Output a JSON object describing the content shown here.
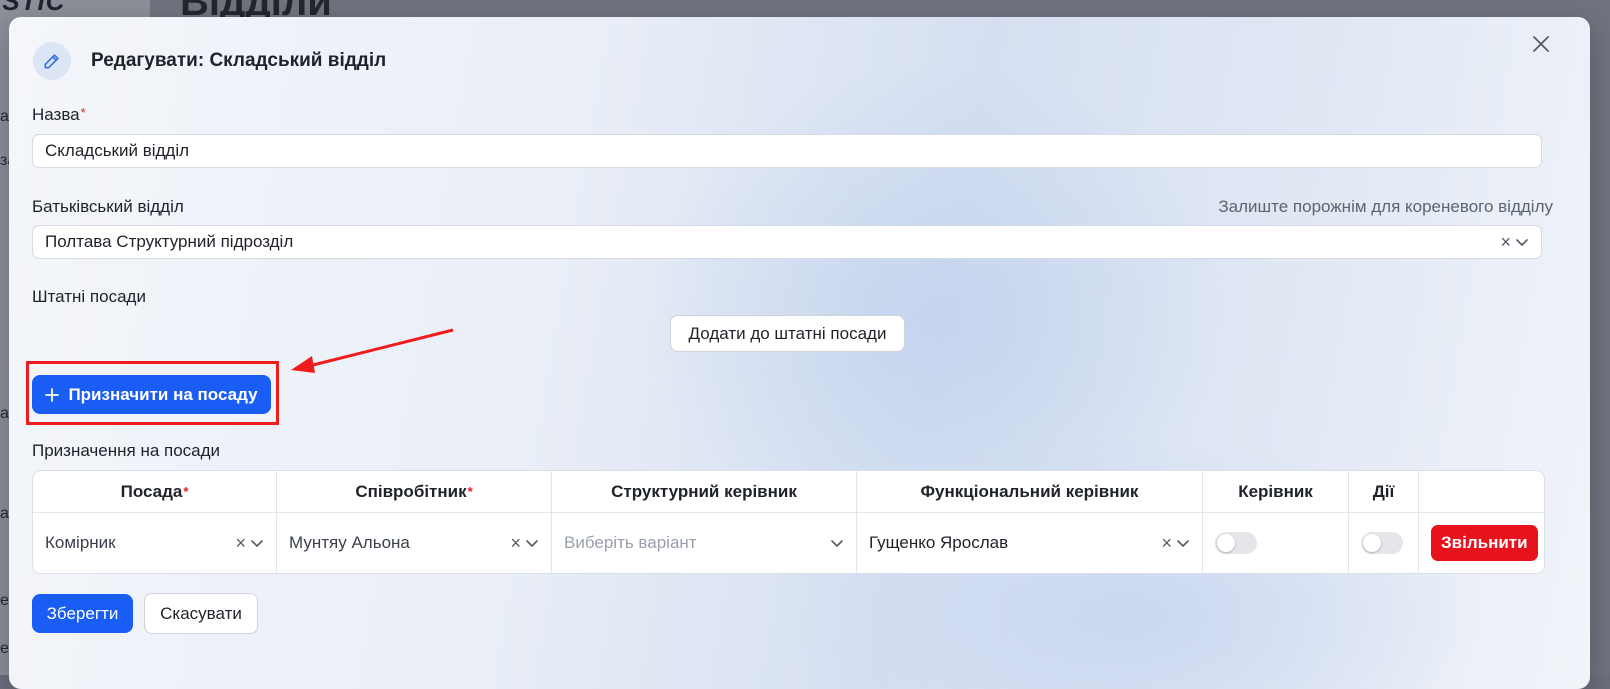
{
  "background": {
    "logo_text": "ISTIC",
    "page_title": "Відділи",
    "sidebar_letters": [
      "а",
      "за",
      "а",
      "ан",
      "е",
      "е"
    ]
  },
  "modal": {
    "title": "Редагувати: Складський відділ",
    "icons": {
      "edit": "edit-pencil-icon",
      "close": "close-icon"
    }
  },
  "form": {
    "name_label": "Назва",
    "name_value": "Складський відділ",
    "parent_label": "Батьківський відділ",
    "parent_hint": "Залиште порожнім для кореневого відділу",
    "parent_value": "Полтава Структурний підрозділ",
    "staff_label": "Штатні посади",
    "add_staff_button": "Додати до штатні посади",
    "assign_button": "Призначити на посаду",
    "assignments_label": "Призначення на посади"
  },
  "table": {
    "columns": [
      "Посада",
      "Співробітник",
      "Структурний керівник",
      "Функціональний керівник",
      "Керівник",
      "Дії",
      ""
    ],
    "required_columns": [
      "Посада",
      "Співробітник"
    ],
    "rows": [
      {
        "position": "Комірник",
        "employee": "Мунтяу Альона",
        "structural_manager_placeholder": "Виберіть варіант",
        "functional_manager": "Гущенко Ярослав",
        "manager_toggle": false,
        "actions_toggle": false,
        "dismiss_button": "Звільнити"
      }
    ]
  },
  "footer": {
    "save_button": "Зберегти",
    "cancel_button": "Скасувати"
  },
  "colors": {
    "primary": "#1a5df5",
    "danger": "#e8121c",
    "annotation": "#ee1c1c"
  },
  "required_mark": "*",
  "clear_glyph": "×"
}
